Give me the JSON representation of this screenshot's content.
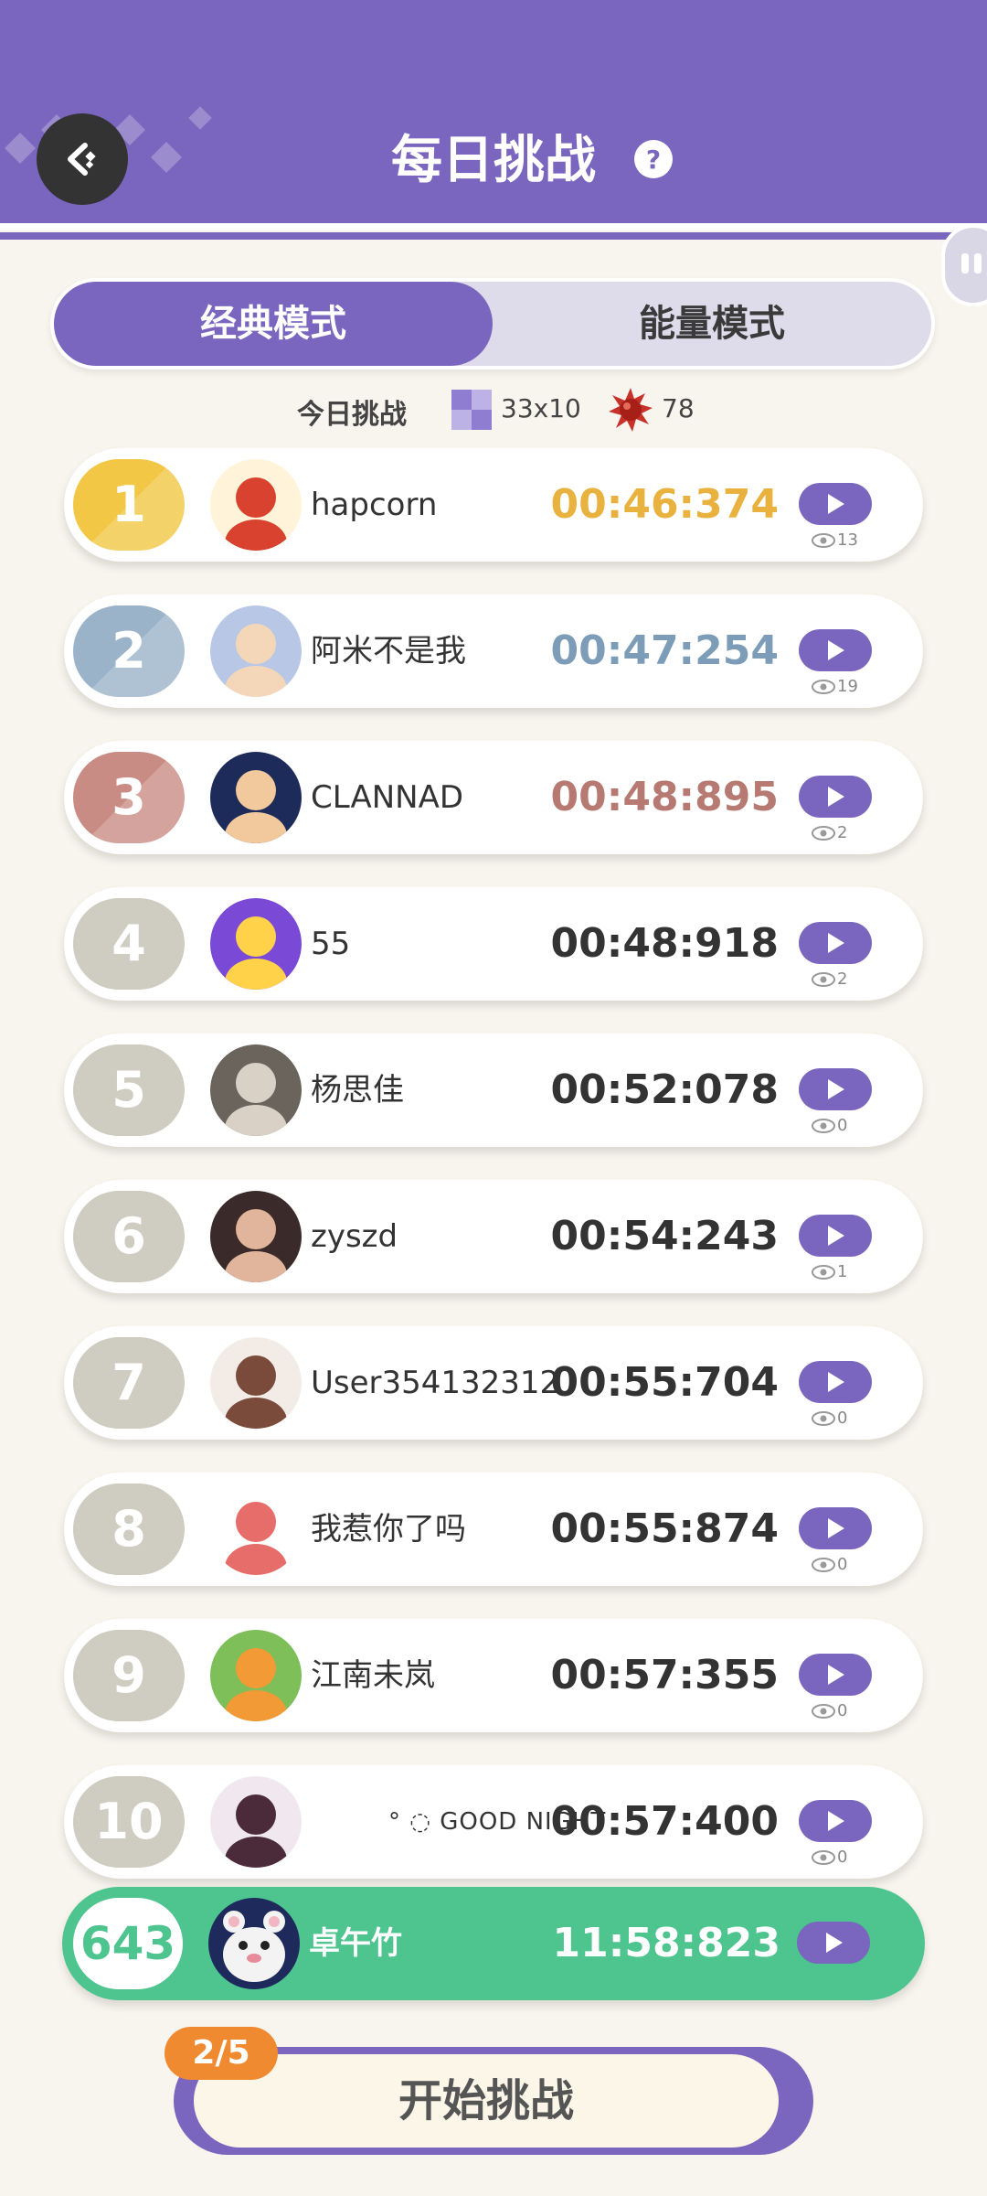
{
  "header": {
    "title": "每日挑战"
  },
  "tabs": [
    {
      "label": "经典模式",
      "active": true
    },
    {
      "label": "能量模式",
      "active": false
    }
  ],
  "challenge_info": {
    "label": "今日挑战",
    "board_size": "33x10",
    "mines": "78"
  },
  "colors": {
    "accent": "#7a66be",
    "gold": "#f2c745",
    "silver": "#9bb3c9",
    "bronze": "#c98c84",
    "grey": "#cfccc2",
    "self": "#4ec48f",
    "orange": "#f08a30"
  },
  "leaderboard": [
    {
      "rank": "1",
      "name": "hapcorn",
      "time": "00:46:374",
      "views": "13",
      "avatar": "popcorn-avatar"
    },
    {
      "rank": "2",
      "name": "阿米不是我",
      "time": "00:47:254",
      "views": "19",
      "avatar": "anime-girls-avatar"
    },
    {
      "rank": "3",
      "name": "CLANNAD",
      "time": "00:48:895",
      "views": "2",
      "avatar": "anime-boy-avatar"
    },
    {
      "rank": "4",
      "name": "55",
      "time": "00:48:918",
      "views": "2",
      "avatar": "cartoon-avatar"
    },
    {
      "rank": "5",
      "name": "杨思佳",
      "time": "00:52:078",
      "views": "0",
      "avatar": "cat-avatar"
    },
    {
      "rank": "6",
      "name": "zyszd",
      "time": "00:54:243",
      "views": "1",
      "avatar": "doll-avatar"
    },
    {
      "rank": "7",
      "name": "User354132312",
      "time": "00:55:704",
      "views": "0",
      "avatar": "anime-girl-avatar"
    },
    {
      "rank": "8",
      "name": "我惹你了吗",
      "time": "00:55:874",
      "views": "0",
      "avatar": "fish-avatar"
    },
    {
      "rank": "9",
      "name": "江南未岚",
      "time": "00:57:355",
      "views": "0",
      "avatar": "tiger-avatar"
    },
    {
      "rank": "10",
      "name": "° ◌ GOOD NIGHT",
      "time": "00:57:400",
      "views": "0",
      "avatar": "anime-girl-dark-avatar"
    }
  ],
  "self": {
    "rank": "643",
    "name": "卓午竹",
    "time": "11:58:823"
  },
  "start": {
    "label": "开始挑战",
    "attempts": "2/5"
  }
}
